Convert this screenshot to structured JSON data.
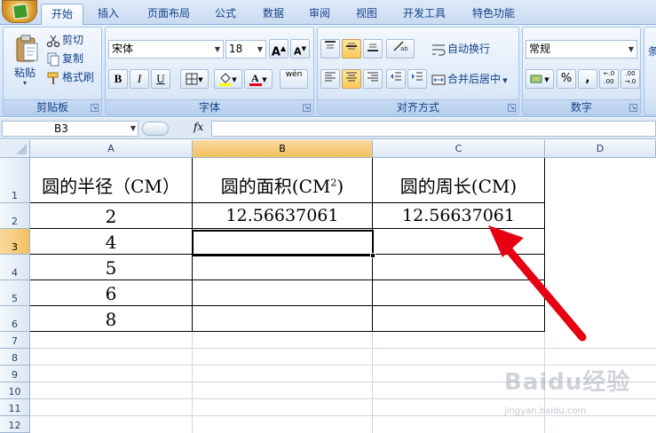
{
  "tabs": [
    {
      "label": "开始",
      "active": true
    },
    {
      "label": "插入"
    },
    {
      "label": "页面布局"
    },
    {
      "label": "公式"
    },
    {
      "label": "数据"
    },
    {
      "label": "审阅"
    },
    {
      "label": "视图"
    },
    {
      "label": "开发工具"
    },
    {
      "label": "特色功能"
    }
  ],
  "ribbon": {
    "clipboard": {
      "paste": "粘贴",
      "cut": "剪切",
      "copy": "复制",
      "format_painter": "格式刷",
      "label": "剪贴板"
    },
    "font": {
      "name": "宋体",
      "size": "18",
      "grow": "A",
      "shrink": "A",
      "bold": "B",
      "italic": "I",
      "underline": "U",
      "phonetic": "wén",
      "label": "字体"
    },
    "alignment": {
      "wrap": "自动换行",
      "merge": "合并后居中",
      "label": "对齐方式"
    },
    "number": {
      "format": "常规",
      "percent": "%",
      "comma": ",",
      "label": "数字"
    },
    "partial_label": "条"
  },
  "formula_bar": {
    "name_box": "B3",
    "fx": "fx",
    "formula": ""
  },
  "sheet": {
    "columns": [
      "A",
      "B",
      "C",
      "D"
    ],
    "selected_column": "B",
    "rows": [
      "1",
      "2",
      "3",
      "4",
      "5",
      "6",
      "7",
      "8",
      "9",
      "10",
      "11",
      "12"
    ],
    "selected_row": "3",
    "active_cell": "B3",
    "cells": {
      "A1": "圆的半径（CM）",
      "B1": "圆的面积(CM",
      "B1_sup": "2",
      "B1_tail": ")",
      "C1": "圆的周长(CM)",
      "A2": "2",
      "B2": "12.56637061",
      "C2": "12.56637061",
      "A3": "4",
      "A4": "5",
      "A5": "6",
      "A6": "8"
    }
  },
  "watermark": {
    "brand": "Baidu经验",
    "url": "jingyan.baidu.com"
  },
  "colors": {
    "accent": "#e60012",
    "selection": "#f1c15f",
    "ribbon": "#d6e5f8"
  }
}
